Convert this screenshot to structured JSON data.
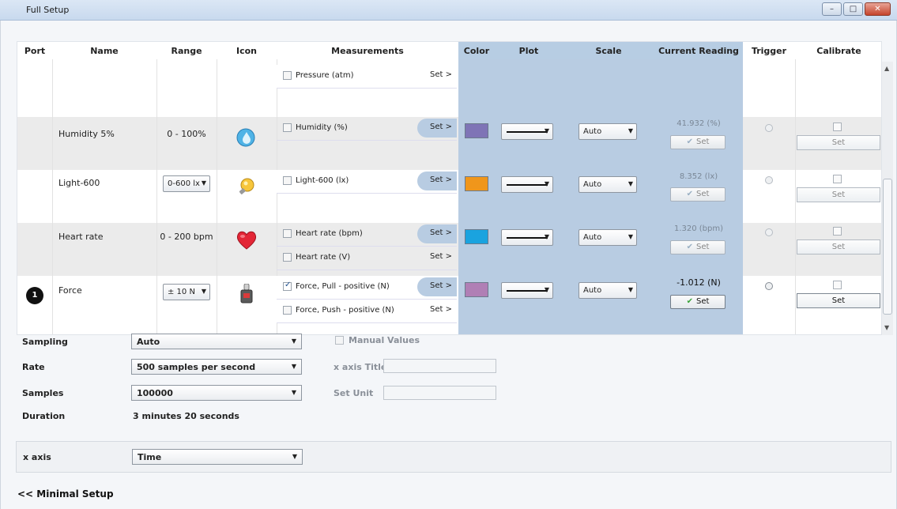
{
  "window": {
    "title": "Full Setup",
    "minimize_glyph": "–",
    "maximize_glyph": "□",
    "close_glyph": "✕"
  },
  "table": {
    "headers": {
      "port": "Port",
      "name": "Name",
      "range": "Range",
      "icon": "Icon",
      "measurements": "Measurements",
      "color": "Color",
      "plot": "Plot",
      "scale": "Scale",
      "current_reading": "Current Reading",
      "trigger": "Trigger",
      "calibrate": "Calibrate"
    },
    "rows": [
      {
        "port": "",
        "name": "",
        "range": "",
        "icon": "",
        "measurements": [
          {
            "label": "Pressure (atm)",
            "checked": false,
            "set": "Set >"
          }
        ]
      },
      {
        "port": "",
        "name": "Humidity 5%",
        "range": "0 - 100%",
        "icon": "water-drop-icon",
        "color": "#7f74b6",
        "scale": "Auto",
        "reading": "41.932 (%)",
        "set_label": "Set",
        "calibrate_label": "Set",
        "measurements": [
          {
            "label": "Humidity (%)",
            "checked": false,
            "set": "Set >"
          }
        ]
      },
      {
        "port": "",
        "name": "Light-600",
        "range": "0-600 lx",
        "icon": "light-bulb-icon",
        "color": "#f0961b",
        "scale": "Auto",
        "reading": "8.352 (lx)",
        "set_label": "Set",
        "calibrate_label": "Set",
        "measurements": [
          {
            "label": "Light-600 (lx)",
            "checked": false,
            "set": "Set >"
          }
        ]
      },
      {
        "port": "",
        "name": "Heart rate",
        "range": "0 - 200 bpm",
        "icon": "heart-icon",
        "color": "#1aa3df",
        "scale": "Auto",
        "reading": "1.320 (bpm)",
        "set_label": "Set",
        "calibrate_label": "Set",
        "measurements": [
          {
            "label": "Heart rate (bpm)",
            "checked": false,
            "set": "Set >"
          },
          {
            "label": "Heart rate (V)",
            "checked": false,
            "set": "Set >"
          }
        ]
      },
      {
        "port": "1",
        "name": "Force",
        "range": "± 10 N",
        "icon": "force-sensor-icon",
        "color": "#b07fb5",
        "scale": "Auto",
        "reading": "-1.012 (N)",
        "set_label": "Set",
        "calibrate_label": "Set",
        "measurements": [
          {
            "label": "Force, Pull - positive (N)",
            "checked": true,
            "set": "Set >"
          },
          {
            "label": "Force, Push - positive (N)",
            "checked": false,
            "set": "Set >"
          }
        ]
      }
    ]
  },
  "bottom": {
    "sampling_label": "Sampling",
    "sampling_value": "Auto",
    "rate_label": "Rate",
    "rate_value": "500 samples per second",
    "samples_label": "Samples",
    "samples_value": "100000",
    "duration_label": "Duration",
    "duration_value": "3 minutes 20 seconds",
    "manual_values_label": "Manual Values",
    "x_axis_title_label": "x axis Title",
    "set_unit_label": "Set Unit",
    "x_axis_label": "x axis",
    "x_axis_value": "Time"
  },
  "footer": {
    "minimal_setup": "<< Minimal Setup"
  },
  "icons": {
    "dropdown_arrow": "▼",
    "check": "✔",
    "scroll_up": "▲",
    "scroll_down": "▼"
  }
}
